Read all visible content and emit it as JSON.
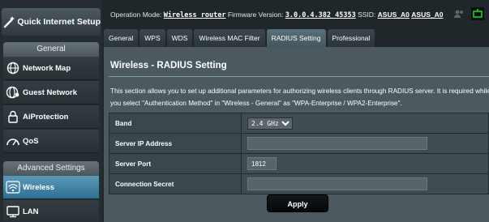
{
  "colors": {
    "accent_active": "#4a87a8",
    "panel_bg": "#4c5a60",
    "router_icon_green": "#17d41c"
  },
  "sidebar": {
    "quick_setup_label": "Quick Internet Setup",
    "general_header": "General",
    "general_items": [
      {
        "label": "Network Map",
        "icon": "globe-icon"
      },
      {
        "label": "Guest Network",
        "icon": "globe-users-icon"
      },
      {
        "label": "AiProtection",
        "icon": "lock-icon"
      },
      {
        "label": "QoS",
        "icon": "gauge-icon"
      }
    ],
    "advanced_header": "Advanced Settings",
    "advanced_items": [
      {
        "label": "Wireless",
        "icon": "wifi-icon",
        "active": true
      },
      {
        "label": "LAN",
        "icon": "monitor-icon",
        "active": false
      }
    ]
  },
  "topbar": {
    "op_mode_label": "Operation Mode:",
    "op_mode_value": "Wireless router",
    "fw_label": "Firmware Version:",
    "fw_value": "3.0.0.4.382_45353",
    "ssid_label": "SSID:",
    "ssid_1": "ASUS_A0",
    "ssid_2": "ASUS_A0"
  },
  "tabs": [
    {
      "label": "General",
      "active": false
    },
    {
      "label": "WPS",
      "active": false
    },
    {
      "label": "WDS",
      "active": false
    },
    {
      "label": "Wireless MAC Filter",
      "active": false
    },
    {
      "label": "RADIUS Setting",
      "active": true
    },
    {
      "label": "Professional",
      "active": false
    }
  ],
  "panel": {
    "title": "Wireless - RADIUS Setting",
    "description": "This section allows you to set up additional parameters for authorizing wireless clients through RADIUS server. It is required while you select \"Authentication Method\" in \"Wireless - General\" as \"WPA-Enterprise / WPA2-Enterprise\".",
    "band_label": "Band",
    "band_value": "2.4 GHz",
    "server_ip_label": "Server IP Address",
    "server_ip_value": "",
    "server_port_label": "Server Port",
    "server_port_value": "1812",
    "secret_label": "Connection Secret",
    "secret_value": "",
    "apply_label": "Apply"
  }
}
